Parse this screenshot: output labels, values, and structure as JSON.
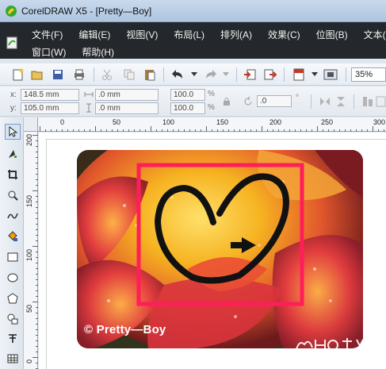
{
  "window": {
    "title": "CorelDRAW X5 - [Pretty—Boy]"
  },
  "menu": {
    "row1": [
      "文件(F)",
      "编辑(E)",
      "视图(V)",
      "布局(L)",
      "排列(A)",
      "效果(C)",
      "位图(B)",
      "文本(X)"
    ],
    "row2": [
      "窗口(W)",
      "帮助(H)"
    ]
  },
  "toolbar": {
    "zoom": "35%"
  },
  "propbar": {
    "x_label": "x:",
    "x_value": "148.5 mm",
    "y_label": "y:",
    "y_value": "105.0 mm",
    "w_value": ".0 mm",
    "h_value": ".0 mm",
    "scale_x": "100.0",
    "scale_y": "100.0",
    "pct": "%",
    "angle": ".0",
    "degree": "°"
  },
  "ruler": {
    "h_labels": [
      "0",
      "50",
      "100",
      "150",
      "200",
      "250",
      "300"
    ],
    "v_labels": [
      "200",
      "150",
      "100",
      "50",
      "0"
    ]
  },
  "canvas": {
    "watermark": "© Pretty—Boy",
    "baidu_logo": "Baidu 经验"
  },
  "colors": {
    "menubar_bg": "#24272b",
    "frame_stroke": "#ff1e5a",
    "heart_stroke": "#111111"
  },
  "icons": {
    "toolbox": [
      "pick-tool-icon",
      "shape-tool-icon",
      "crop-tool-icon",
      "zoom-tool-icon",
      "freehand-tool-icon",
      "smart-fill-icon",
      "rectangle-tool-icon",
      "ellipse-tool-icon",
      "polygon-tool-icon",
      "basic-shapes-icon",
      "text-tool-icon",
      "table-tool-icon"
    ]
  }
}
